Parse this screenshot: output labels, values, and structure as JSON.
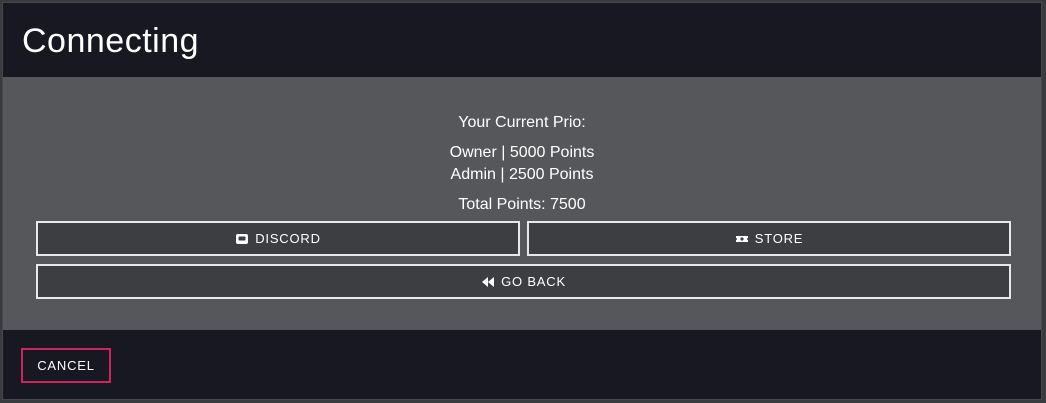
{
  "modal": {
    "title": "Connecting"
  },
  "prio": {
    "heading": "Your Current Prio:",
    "entries": [
      "Owner | 5000 Points",
      "Admin | 2500 Points"
    ],
    "total": "Total Points: 7500"
  },
  "buttons": {
    "discord": "DISCORD",
    "store": "STORE",
    "go_back": "GO BACK",
    "cancel": "CANCEL"
  },
  "icons": {
    "discord": "discord-icon",
    "store": "ticket-icon",
    "go_back": "rewind-icon"
  },
  "colors": {
    "header_bg": "#171822",
    "body_bg": "#55575a",
    "button_bg": "#3d3e42",
    "cancel_border": "#d0245e"
  }
}
